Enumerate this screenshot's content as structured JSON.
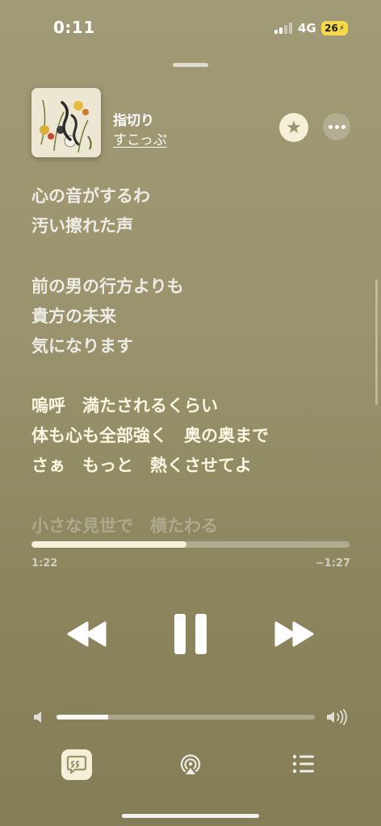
{
  "status_bar": {
    "time": "0:11",
    "network": "4G",
    "battery": "26"
  },
  "now_playing": {
    "title": "指切り",
    "artist": "すこっぷ"
  },
  "lyrics": [
    {
      "text": "心の音がするわ",
      "state": "past"
    },
    {
      "text": "汚い擦れた声",
      "state": "past"
    },
    {
      "text": "前の男の行方よりも",
      "state": "past"
    },
    {
      "text": "貴方の未来",
      "state": "past"
    },
    {
      "text": "気になります",
      "state": "past"
    },
    {
      "text": "嗚呼　満たされるくらい",
      "state": "current"
    },
    {
      "text": "体も心も全部強く　奥の奥まで",
      "state": "current"
    },
    {
      "text": "さぁ　もっと　熱くさせてよ",
      "state": "current"
    },
    {
      "text": "小さな見世で　横たわる",
      "state": "upcoming"
    }
  ],
  "playback": {
    "elapsed": "1:22",
    "remaining": "−1:27",
    "progress": 0.487
  },
  "volume": {
    "level": 0.2
  },
  "colors": {
    "accent": "#f4efd6",
    "background": "#9a936d"
  },
  "icons": [
    "star-icon",
    "more-icon",
    "rewind-icon",
    "pause-icon",
    "fast-forward-icon",
    "volume-low-icon",
    "volume-high-icon",
    "lyrics-icon",
    "airplay-icon",
    "queue-icon"
  ]
}
